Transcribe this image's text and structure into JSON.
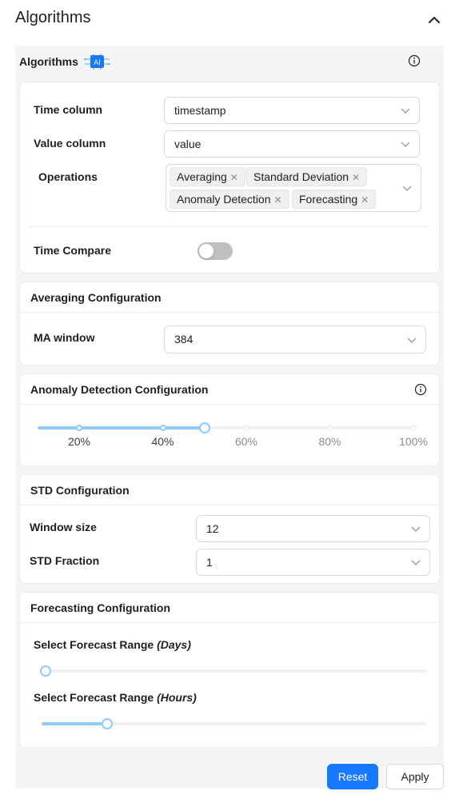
{
  "header": {
    "title": "Algorithms"
  },
  "algorithms": {
    "title": "Algorithms",
    "badge": "AI",
    "time_column": {
      "label": "Time column",
      "value": "timestamp"
    },
    "value_column": {
      "label": "Value column",
      "value": "value"
    },
    "operations": {
      "label": "Operations",
      "tags": [
        "Averaging",
        "Standard Deviation",
        "Anomaly Detection",
        "Forecasting"
      ]
    },
    "time_compare": {
      "label": "Time Compare",
      "enabled": false
    }
  },
  "averaging": {
    "title": "Averaging Configuration",
    "ma_window": {
      "label": "MA window",
      "value": "384"
    }
  },
  "anomaly": {
    "title": "Anomaly Detection Configuration",
    "slider_marks": [
      "20%",
      "40%",
      "60%",
      "80%",
      "100%"
    ],
    "slider_value_percent": 50
  },
  "std": {
    "title": "STD Configuration",
    "window_size": {
      "label": "Window size",
      "value": "12"
    },
    "std_fraction": {
      "label": "STD Fraction",
      "value": "1"
    }
  },
  "forecasting": {
    "title": "Forecasting Configuration",
    "range_days": {
      "label": "Select Forecast Range ",
      "unit": "(Days)",
      "value_fraction": 0.0
    },
    "range_hours": {
      "label": "Select Forecast Range ",
      "unit": "(Hours)",
      "value_fraction": 0.17
    }
  },
  "buttons": {
    "reset": "Reset",
    "apply": "Apply"
  },
  "colors": {
    "primary": "#1677ff",
    "slider_track": "#91caff"
  }
}
